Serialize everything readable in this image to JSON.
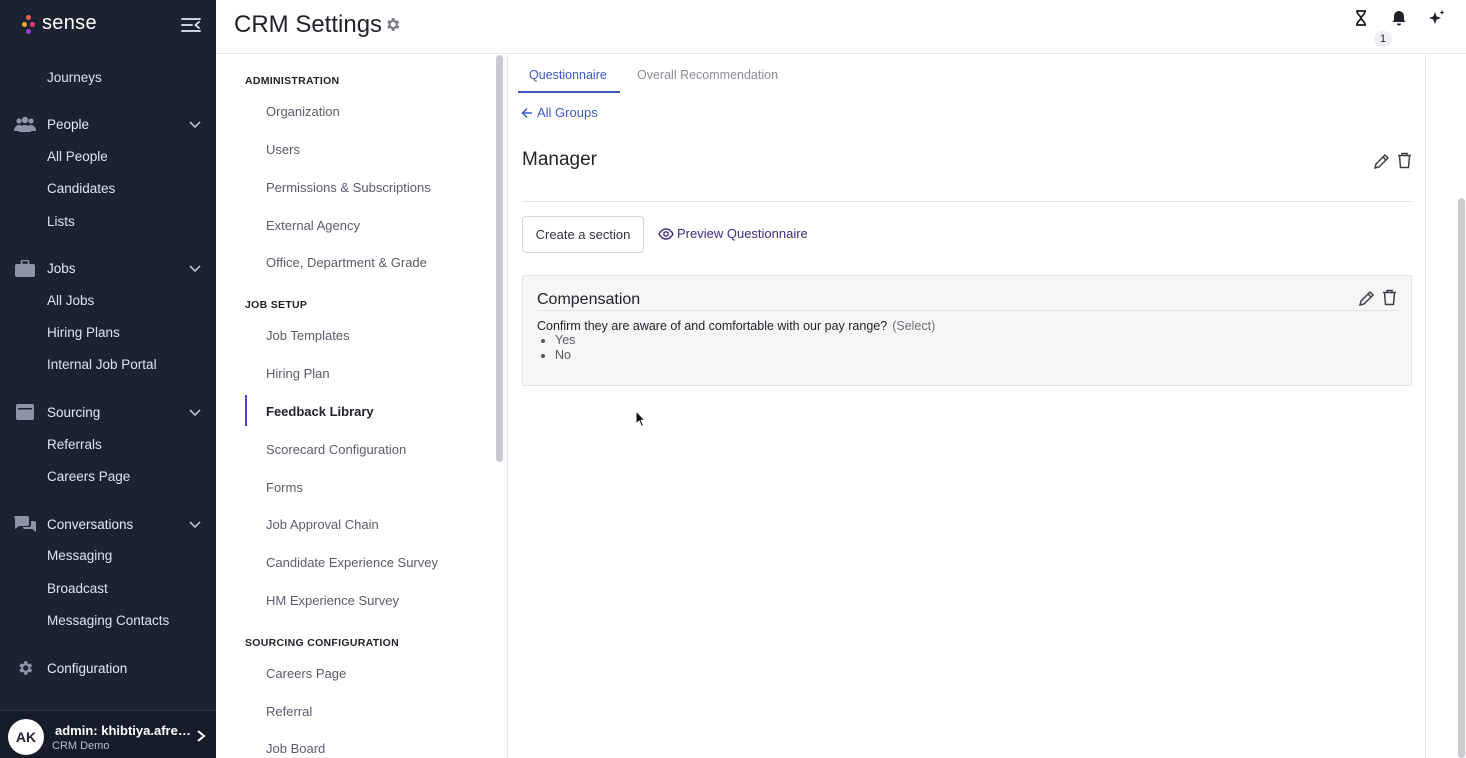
{
  "app": {
    "logo_text": "sense"
  },
  "sidebar": {
    "items": [
      {
        "label": "Journeys"
      },
      {
        "label": "People"
      },
      {
        "label": "All People"
      },
      {
        "label": "Candidates"
      },
      {
        "label": "Lists"
      },
      {
        "label": "Jobs"
      },
      {
        "label": "All Jobs"
      },
      {
        "label": "Hiring Plans"
      },
      {
        "label": "Internal Job Portal"
      },
      {
        "label": "Sourcing"
      },
      {
        "label": "Referrals"
      },
      {
        "label": "Careers Page"
      },
      {
        "label": "Conversations"
      },
      {
        "label": "Messaging"
      },
      {
        "label": "Broadcast"
      },
      {
        "label": "Messaging Contacts"
      },
      {
        "label": "Configuration"
      }
    ],
    "user": {
      "initials": "AK",
      "name": "admin: khibtiya.afreen@sen",
      "org": "CRM Demo"
    }
  },
  "header": {
    "title": "CRM Settings",
    "notification_count": "1",
    "icons": [
      "hourglass-icon",
      "bell-icon",
      "sparkle-icon",
      "gear-icon"
    ]
  },
  "settings_menu": {
    "sections": [
      {
        "title": "ADMINISTRATION"
      },
      {
        "title": "JOB SETUP"
      },
      {
        "title": "SOURCING CONFIGURATION"
      }
    ],
    "items": [
      {
        "label": "Organization"
      },
      {
        "label": "Users"
      },
      {
        "label": "Permissions & Subscriptions"
      },
      {
        "label": "External Agency"
      },
      {
        "label": "Office, Department & Grade"
      },
      {
        "label": "Job Templates"
      },
      {
        "label": "Hiring Plan"
      },
      {
        "label": "Feedback Library"
      },
      {
        "label": "Scorecard Configuration"
      },
      {
        "label": "Forms"
      },
      {
        "label": "Job Approval Chain"
      },
      {
        "label": "Candidate Experience Survey"
      },
      {
        "label": "HM Experience Survey"
      },
      {
        "label": "Careers Page"
      },
      {
        "label": "Referral"
      },
      {
        "label": "Job Board"
      }
    ],
    "active": "Feedback Library"
  },
  "content": {
    "tabs": [
      {
        "label": "Questionnaire",
        "active": true
      },
      {
        "label": "Overall Recommendation",
        "active": false
      }
    ],
    "back_link": "All Groups",
    "group_title": "Manager",
    "create_section_label": "Create a section",
    "preview_label": "Preview Questionnaire",
    "section": {
      "title": "Compensation",
      "question": "Confirm they are aware of and comfortable with our pay range?",
      "question_type": "(Select)",
      "options": [
        "Yes",
        "No"
      ]
    }
  },
  "colors": {
    "sidebar_bg": "#1b2230",
    "accent_blue": "#3d5bc4",
    "active_bar": "#5b3fc4",
    "preview_link": "#3a2f86"
  }
}
